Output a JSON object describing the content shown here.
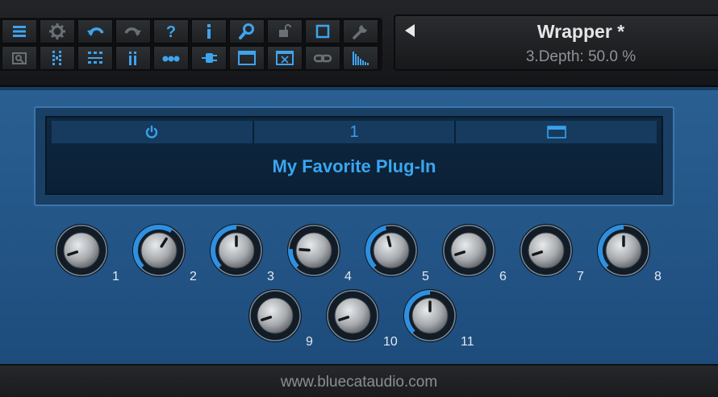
{
  "colors": {
    "accent_blue": "#3aa6f0",
    "panel_blue": "#2a5f92",
    "knob_arc": "#2f8fe0",
    "toolbar_bg": "#1a1c1f",
    "label_white": "#e4e8ee"
  },
  "toolbar": {
    "row1": [
      {
        "name": "menu-icon"
      },
      {
        "name": "settings-gear-icon"
      },
      {
        "name": "undo-icon"
      },
      {
        "name": "redo-icon"
      },
      {
        "name": "help-question-icon"
      },
      {
        "name": "info-icon"
      },
      {
        "name": "search-icon"
      },
      {
        "name": "lock-icon"
      },
      {
        "name": "square-icon"
      },
      {
        "name": "wrench-icon"
      }
    ],
    "row2": [
      {
        "name": "preset-browser-icon"
      },
      {
        "name": "parameters-icon"
      },
      {
        "name": "grid-icon"
      },
      {
        "name": "meters-icon"
      },
      {
        "name": "chain-dots-icon"
      },
      {
        "name": "plug-icon"
      },
      {
        "name": "window-icon"
      },
      {
        "name": "close-window-icon"
      },
      {
        "name": "link-icon"
      },
      {
        "name": "spectrum-icon"
      }
    ]
  },
  "display": {
    "preset_name": "Wrapper *",
    "param_readout": "3.Depth: 50.0 %"
  },
  "slot": {
    "slot_number": "1",
    "plugin_name": "My Favorite Plug-In"
  },
  "knobs": [
    {
      "label": "1",
      "value": 0.1
    },
    {
      "label": "2",
      "value": 0.62
    },
    {
      "label": "3",
      "value": 0.5
    },
    {
      "label": "4",
      "value": 0.18
    },
    {
      "label": "5",
      "value": 0.45
    },
    {
      "label": "6",
      "value": 0.1
    },
    {
      "label": "7",
      "value": 0.1
    },
    {
      "label": "8",
      "value": 0.5
    },
    {
      "label": "9",
      "value": 0.1
    },
    {
      "label": "10",
      "value": 0.1
    },
    {
      "label": "11",
      "value": 0.5
    }
  ],
  "footer": {
    "text": "www.bluecataudio.com"
  }
}
